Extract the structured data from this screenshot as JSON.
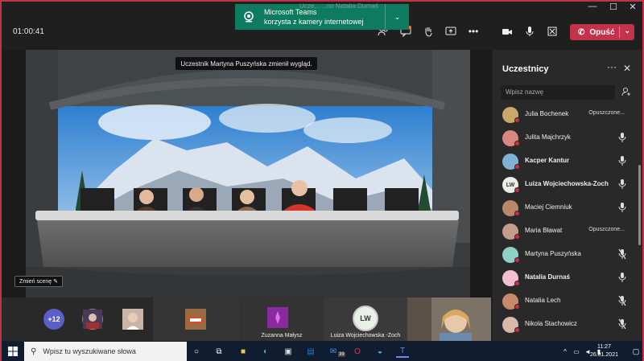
{
  "window": {
    "minimize": "—",
    "maximize": "☐",
    "close": "✕"
  },
  "call": {
    "timer": "01:00:41",
    "leave_label": "Opuść"
  },
  "toast": {
    "ghost_text": "Ucze... ...no Natalia Durnaś",
    "line1": "Microsoft Teams",
    "line2": "korzysta z kamery internetowej"
  },
  "stage": {
    "notice": "Uczestnik Martyna Puszyńska zmienił wygląd.",
    "change_scene": "Zmień scenę"
  },
  "strip": {
    "overflow_count": "+12",
    "tiles": [
      {
        "name": ""
      },
      {
        "name": ""
      },
      {
        "name": "Zuzanna Małysz"
      },
      {
        "name": "Luiza Wojciechowska -Zoch",
        "initials": "LW"
      },
      {
        "name": ""
      }
    ]
  },
  "panel": {
    "title": "Uczestnicy",
    "search_placeholder": "Wpisz nazwę",
    "participants": [
      {
        "name": "Julia Bochenek",
        "status": "Opuszczone...",
        "bold": false,
        "color": "#c9a86a"
      },
      {
        "name": "Julita Majchrzyk",
        "mic": "on",
        "bold": false,
        "color": "#d98880"
      },
      {
        "name": "Kacper Kantur",
        "mic": "on",
        "bold": true,
        "color": "#7fb3d5"
      },
      {
        "name": "Luiza Wojciechowska-Zoch",
        "mic": "on",
        "bold": true,
        "color": "#e8f0e8",
        "initials": "LW"
      },
      {
        "name": "Maciej Ciemniuk",
        "mic": "on",
        "bold": false,
        "color": "#b9876a"
      },
      {
        "name": "Maria Bławat",
        "status": "Opuszczone...",
        "bold": false,
        "color": "#c39b8f"
      },
      {
        "name": "Martyna Puszyńska",
        "mic": "off",
        "bold": false,
        "color": "#8fd1c6"
      },
      {
        "name": "Natalia Durnaś",
        "mic": "on",
        "bold": true,
        "color": "#f0c0d0"
      },
      {
        "name": "Natalia Lech",
        "mic": "off",
        "bold": false,
        "color": "#c58a6a"
      },
      {
        "name": "Nikola Stachowicz",
        "mic": "off",
        "bold": false,
        "color": "#d8b8a8"
      }
    ]
  },
  "taskbar": {
    "search_placeholder": "Wpisz tu wyszukiwane słowa",
    "time": "11:27",
    "date": "26.01.2021",
    "badge": "39"
  }
}
